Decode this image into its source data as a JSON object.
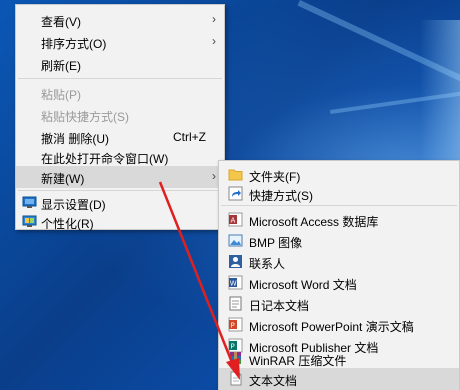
{
  "context_menu": {
    "items": [
      {
        "label": "查看(V)",
        "has_submenu": true
      },
      {
        "label": "排序方式(O)",
        "has_submenu": true
      },
      {
        "label": "刷新(E)"
      },
      {
        "label": "粘贴(P)",
        "disabled": true
      },
      {
        "label": "粘贴快捷方式(S)",
        "disabled": true
      },
      {
        "label": "撤消 删除(U)",
        "shortcut": "Ctrl+Z"
      },
      {
        "label": "在此处打开命令窗口(W)"
      },
      {
        "label": "新建(W)",
        "has_submenu": true,
        "highlighted": true
      },
      {
        "label": "显示设置(D)",
        "icon": "display-settings-icon"
      },
      {
        "label": "个性化(R)",
        "icon": "personalize-icon"
      }
    ]
  },
  "new_submenu": {
    "items": [
      {
        "label": "文件夹(F)",
        "icon": "folder-icon"
      },
      {
        "label": "快捷方式(S)",
        "icon": "shortcut-icon"
      },
      {
        "label": "Microsoft Access 数据库",
        "icon": "access-icon"
      },
      {
        "label": "BMP 图像",
        "icon": "bmp-image-icon"
      },
      {
        "label": "联系人",
        "icon": "contact-icon"
      },
      {
        "label": "Microsoft Word 文档",
        "icon": "word-document-icon"
      },
      {
        "label": "日记本文档",
        "icon": "journal-document-icon"
      },
      {
        "label": "Microsoft PowerPoint 演示文稿",
        "icon": "powerpoint-icon"
      },
      {
        "label": "Microsoft Publisher 文档",
        "icon": "publisher-icon"
      },
      {
        "label": "WinRAR 压缩文件",
        "icon": "winrar-icon"
      },
      {
        "label": "文本文档",
        "icon": "text-document-icon",
        "highlighted": true
      }
    ]
  },
  "colors": {
    "menu_bg": "#f2f2f2",
    "highlight": "#d9d9d9",
    "annotation_arrow": "#e02020"
  }
}
